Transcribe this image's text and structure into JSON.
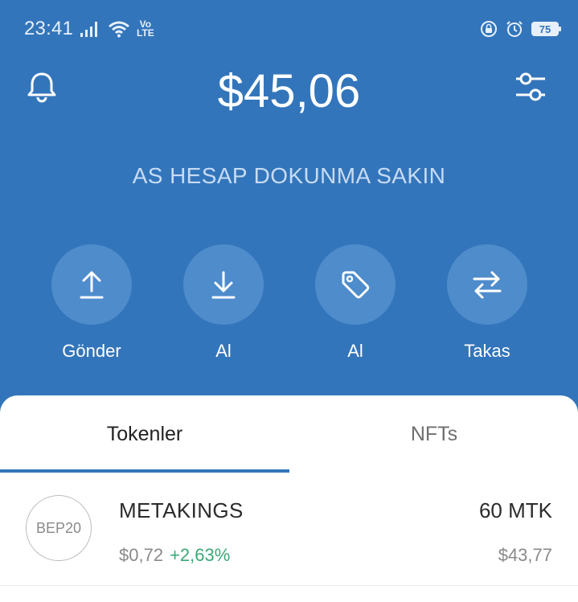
{
  "status_bar": {
    "time": "23:41",
    "volte_top": "Vo",
    "volte_bottom": "LTE",
    "battery": "75"
  },
  "header": {
    "balance": "$45,06",
    "wallet_name": "AS HESAP DOKUNMA SAKIN"
  },
  "actions": [
    {
      "label": "Gönder",
      "icon": "upload-icon"
    },
    {
      "label": "Al",
      "icon": "download-icon"
    },
    {
      "label": "Al",
      "icon": "tag-icon"
    },
    {
      "label": "Takas",
      "icon": "swap-icon"
    }
  ],
  "tabs": [
    {
      "label": "Tokenler",
      "active": true
    },
    {
      "label": "NFTs",
      "active": false
    }
  ],
  "tokens": [
    {
      "logo_text": "BEP20",
      "name": "METAKINGS",
      "price": "$0,72",
      "change": "+2,63%",
      "amount": "60 MTK",
      "value": "$43,77"
    }
  ],
  "colors": {
    "primary": "#3375bb",
    "positive": "#3aa876"
  }
}
